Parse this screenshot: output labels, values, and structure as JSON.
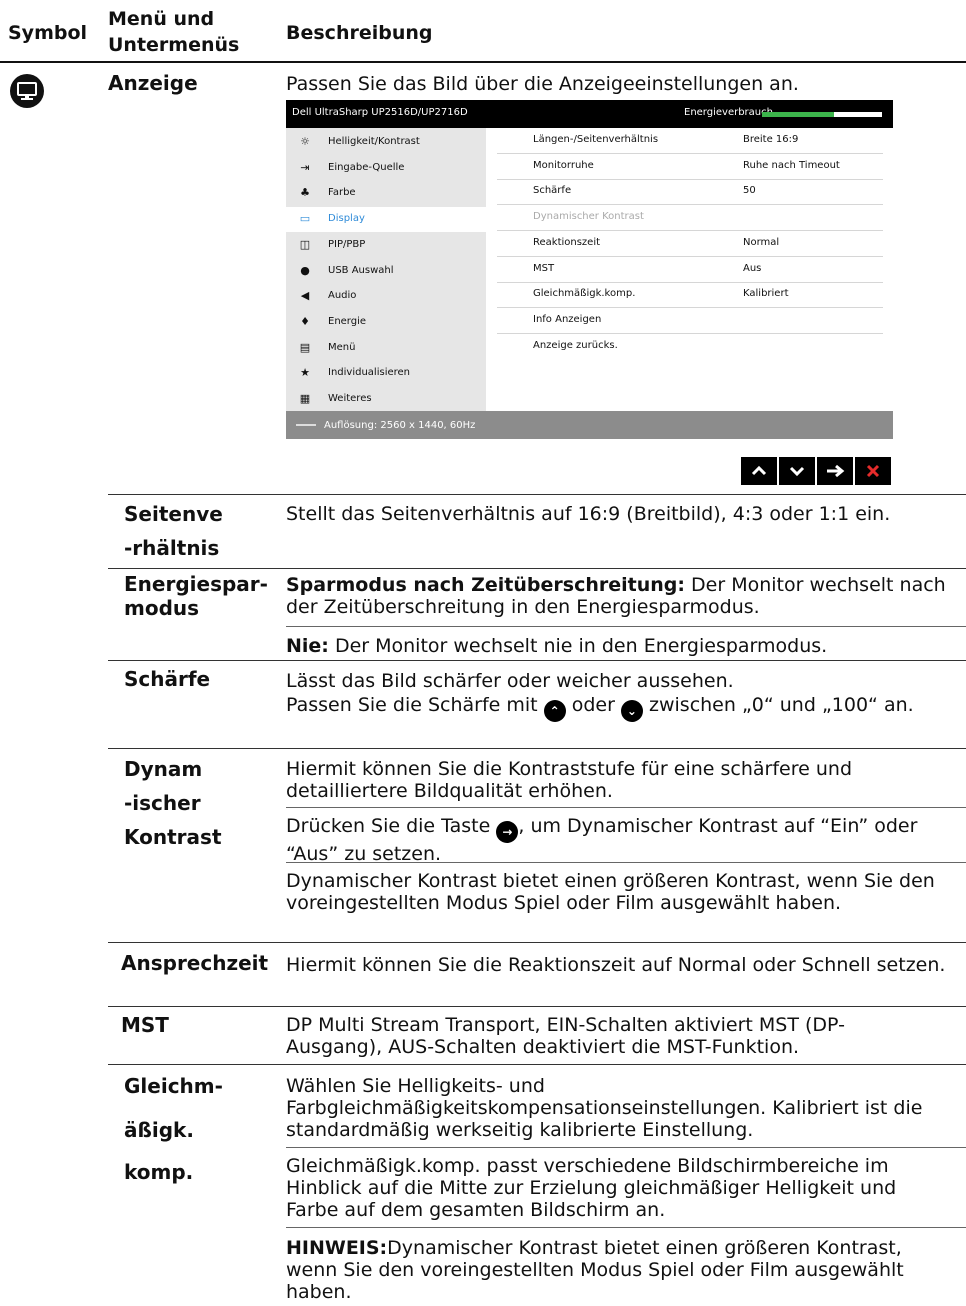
{
  "header": {
    "col_symbol": "Symbol",
    "col_menu_line1": "Menü und",
    "col_menu_line2": "Untermenüs",
    "col_desc": "Beschreibung"
  },
  "main_row": {
    "icon": "monitor-icon",
    "title": "Anzeige",
    "desc": "Passen Sie das Bild über die Anzeigeeinstellungen an."
  },
  "osd": {
    "title": "Dell UltraSharp UP2516D/UP2716D",
    "energy_label": "Energieverbrauch",
    "energy_level": 0.6,
    "menu": [
      {
        "icon": "sun-icon",
        "glyph": "☼",
        "label": "Helligkeit/Kontrast"
      },
      {
        "icon": "input-icon",
        "glyph": "⇥",
        "label": "Eingabe-Quelle"
      },
      {
        "icon": "color-icon",
        "glyph": "♣",
        "label": "Farbe"
      },
      {
        "icon": "display-icon",
        "glyph": "▭",
        "label": "Display"
      },
      {
        "icon": "pip-icon",
        "glyph": "◫",
        "label": "PIP/PBP"
      },
      {
        "icon": "usb-icon",
        "glyph": "●",
        "label": "USB Auswahl"
      },
      {
        "icon": "audio-icon",
        "glyph": "◀",
        "label": "Audio"
      },
      {
        "icon": "power-icon",
        "glyph": "♦",
        "label": "Energie"
      },
      {
        "icon": "menu-icon",
        "glyph": "▤",
        "label": "Menü"
      },
      {
        "icon": "star-icon",
        "glyph": "★",
        "label": "Individualisieren"
      },
      {
        "icon": "other-icon",
        "glyph": "▦",
        "label": "Weiteres"
      }
    ],
    "settings": [
      {
        "k": "Längen-/Seitenverhältnis",
        "v": "Breite 16:9"
      },
      {
        "k": "Monitorruhe",
        "v": "Ruhe nach Timeout"
      },
      {
        "k": "Schärfe",
        "v": "50"
      },
      {
        "k": "Dynamischer Kontrast",
        "v": ""
      },
      {
        "k": "Reaktionszeit",
        "v": "Normal"
      },
      {
        "k": "MST",
        "v": "Aus"
      },
      {
        "k": "Gleichmäßigk.komp.",
        "v": "Kalibriert"
      },
      {
        "k": "Info Anzeigen",
        "v": ""
      },
      {
        "k": "Anzeige zurücks.",
        "v": ""
      }
    ],
    "resolution": "Auflösung: 2560 x 1440, 60Hz",
    "nav_buttons": [
      {
        "name": "up-arrow-icon",
        "glyph": "⌃"
      },
      {
        "name": "down-arrow-icon",
        "glyph": "⌄"
      },
      {
        "name": "right-arrow-icon",
        "glyph": "→"
      },
      {
        "name": "close-icon",
        "glyph": "✕"
      }
    ]
  },
  "rows": {
    "seitenverhaeltnis": {
      "title1": "Seitenve",
      "title2": "-rhältnis",
      "desc": "Stellt das Seitenverhältnis auf 16:9 (Breitbild), 4:3 oder 1:1 ein."
    },
    "energiesparmodus": {
      "title1": "Energiespar-",
      "title2": "modus",
      "desc1_bold": "Sparmodus nach Zeitüberschreitung:",
      "desc1_rest": " Der Monitor wechselt nach der Zeitüberschreitung in den Energiesparmodus.",
      "desc2_bold": "Nie:",
      "desc2_rest": " Der Monitor wechselt nie in den Energiesparmodus."
    },
    "schaerfe": {
      "title": "Schärfe",
      "desc1": "Lässt das Bild schärfer oder weicher aussehen.",
      "desc2a": "Passen Sie die Schärfe mit",
      "desc2b": "oder",
      "desc2c": "zwischen „0“ und „100“ an."
    },
    "dynamischer_kontrast": {
      "title1": "Dynam",
      "title2": "-ischer",
      "title3": "Kontrast",
      "desc1": "Hiermit können Sie die Kontraststufe für eine schärfere und detailliertere Bildqualität erhöhen.",
      "desc2a": "Drücken Sie die Taste",
      "desc2b": ", um Dynamischer Kontrast auf “Ein” oder “Aus” zu setzen.",
      "desc3": "Dynamischer Kontrast bietet einen größeren Kontrast, wenn Sie den voreingestellten Modus Spiel oder Film ausgewählt haben."
    },
    "ansprechzeit": {
      "title": "Ansprechzeit",
      "desc": "Hiermit können Sie die Reaktionszeit auf Normal oder Schnell setzen."
    },
    "mst": {
      "title": "MST",
      "desc": "DP Multi Stream Transport,  EIN-Schalten aktiviert MST (DP-Ausgang), AUS-Schalten deaktiviert die MST-Funktion."
    },
    "gleichmaessigkeit": {
      "title1": "Gleichm-",
      "title2": "äßigk.",
      "title3": "komp.",
      "desc1": "Wählen Sie Helligkeits- und Farbgleichmäßigkeitskompensationseinstellungen. Kalibriert ist die standardmäßig werkseitig kalibrierte Einstellung.",
      "desc2": "Gleichmäßigk.komp. passt verschiedene Bildschirmbereiche im Hinblick auf die Mitte zur Erzielung gleichmäßiger Helligkeit und Farbe auf dem gesamten Bildschirm an.",
      "note_bold": "HINWEIS:",
      "note_rest": "Dynamischer Kontrast bietet einen größeren Kontrast, wenn Sie den voreingestellten Modus Spiel oder Film ausgewählt haben."
    }
  }
}
